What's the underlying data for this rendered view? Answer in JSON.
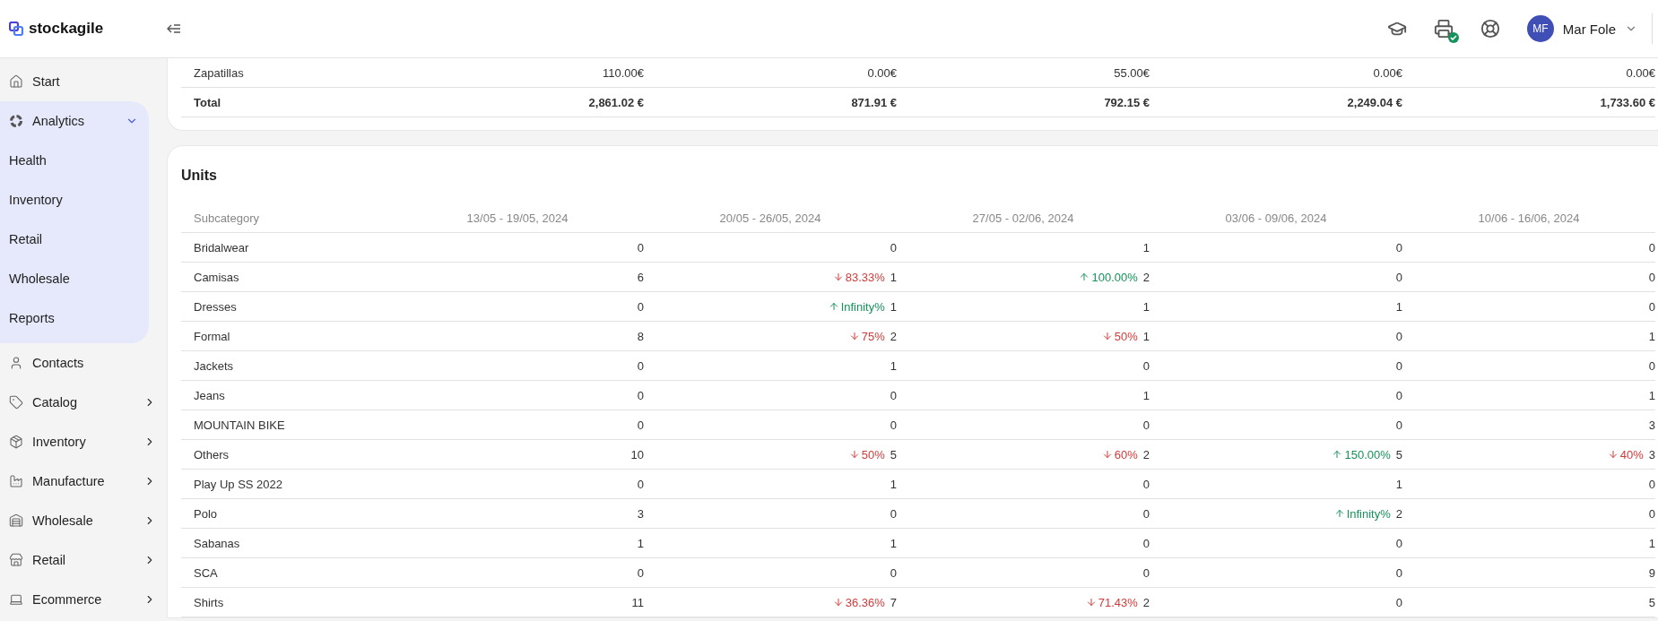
{
  "brand": {
    "name": "stockagile"
  },
  "sidebar": {
    "items": [
      {
        "label": "Start",
        "kind": "link"
      },
      {
        "label": "Analytics",
        "kind": "group",
        "expanded": true,
        "children": [
          {
            "label": "Health"
          },
          {
            "label": "Inventory"
          },
          {
            "label": "Retail"
          },
          {
            "label": "Wholesale"
          },
          {
            "label": "Reports"
          }
        ]
      },
      {
        "label": "Contacts",
        "kind": "link"
      },
      {
        "label": "Catalog",
        "kind": "group",
        "expanded": false
      },
      {
        "label": "Inventory",
        "kind": "group",
        "expanded": false
      },
      {
        "label": "Manufacture",
        "kind": "group",
        "expanded": false
      },
      {
        "label": "Wholesale",
        "kind": "group",
        "expanded": false
      },
      {
        "label": "Retail",
        "kind": "group",
        "expanded": false
      },
      {
        "label": "Ecommerce",
        "kind": "group",
        "expanded": false
      }
    ]
  },
  "header": {
    "printer_connected": true,
    "user": {
      "initials": "MF",
      "name": "Mar Fole"
    }
  },
  "revenue_table": {
    "rows": [
      {
        "kind": "row",
        "label": "Zapatillas",
        "values": [
          "110.00€",
          "0.00€",
          "55.00€",
          "0.00€",
          "0.00€"
        ]
      },
      {
        "kind": "total",
        "label": "Total",
        "values": [
          "2,861.02 €",
          "871.91 €",
          "792.15 €",
          "2,249.04 €",
          "1,733.60 €"
        ]
      }
    ]
  },
  "units": {
    "title": "Units",
    "columns": [
      "Subcategory",
      "13/05 - 19/05, 2024",
      "20/05 - 26/05, 2024",
      "27/05 - 02/06, 2024",
      "03/06 - 09/06, 2024",
      "10/06 - 16/06, 2024"
    ],
    "rows": [
      {
        "label": "Bridalwear",
        "cells": [
          {
            "value": "0"
          },
          {
            "value": "0"
          },
          {
            "value": "1"
          },
          {
            "value": "0"
          },
          {
            "value": "0"
          }
        ]
      },
      {
        "label": "Camisas",
        "cells": [
          {
            "value": "6"
          },
          {
            "value": "1",
            "change": {
              "kind": "decrease",
              "text": "83.33%"
            }
          },
          {
            "value": "2",
            "change": {
              "kind": "increase",
              "text": "100.00%"
            }
          },
          {
            "value": "0"
          },
          {
            "value": "0"
          }
        ]
      },
      {
        "label": "Dresses",
        "cells": [
          {
            "value": "0"
          },
          {
            "value": "1",
            "change": {
              "kind": "increase",
              "text": "Infinity%"
            }
          },
          {
            "value": "1"
          },
          {
            "value": "1"
          },
          {
            "value": "0"
          }
        ]
      },
      {
        "label": "Formal",
        "cells": [
          {
            "value": "8"
          },
          {
            "value": "2",
            "change": {
              "kind": "decrease",
              "text": "75%"
            }
          },
          {
            "value": "1",
            "change": {
              "kind": "decrease",
              "text": "50%"
            }
          },
          {
            "value": "0"
          },
          {
            "value": "1"
          }
        ]
      },
      {
        "label": "Jackets",
        "cells": [
          {
            "value": "0"
          },
          {
            "value": "1"
          },
          {
            "value": "0"
          },
          {
            "value": "0"
          },
          {
            "value": "0"
          }
        ]
      },
      {
        "label": "Jeans",
        "cells": [
          {
            "value": "0"
          },
          {
            "value": "0"
          },
          {
            "value": "1"
          },
          {
            "value": "0"
          },
          {
            "value": "1"
          }
        ]
      },
      {
        "label": "MOUNTAIN BIKE",
        "cells": [
          {
            "value": "0"
          },
          {
            "value": "0"
          },
          {
            "value": "0"
          },
          {
            "value": "0"
          },
          {
            "value": "3"
          }
        ]
      },
      {
        "label": "Others",
        "cells": [
          {
            "value": "10"
          },
          {
            "value": "5",
            "change": {
              "kind": "decrease",
              "text": "50%"
            }
          },
          {
            "value": "2",
            "change": {
              "kind": "decrease",
              "text": "60%"
            }
          },
          {
            "value": "5",
            "change": {
              "kind": "increase",
              "text": "150.00%"
            }
          },
          {
            "value": "3",
            "change": {
              "kind": "decrease",
              "text": "40%"
            }
          }
        ]
      },
      {
        "label": "Play Up SS 2022",
        "cells": [
          {
            "value": "0"
          },
          {
            "value": "1"
          },
          {
            "value": "0"
          },
          {
            "value": "1"
          },
          {
            "value": "0"
          }
        ]
      },
      {
        "label": "Polo",
        "cells": [
          {
            "value": "3"
          },
          {
            "value": "0"
          },
          {
            "value": "0"
          },
          {
            "value": "2",
            "change": {
              "kind": "increase",
              "text": "Infinity%"
            }
          },
          {
            "value": "0"
          }
        ]
      },
      {
        "label": "Sabanas",
        "cells": [
          {
            "value": "1"
          },
          {
            "value": "1"
          },
          {
            "value": "0"
          },
          {
            "value": "0"
          },
          {
            "value": "1"
          }
        ]
      },
      {
        "label": "SCA",
        "cells": [
          {
            "value": "0"
          },
          {
            "value": "0"
          },
          {
            "value": "0"
          },
          {
            "value": "0"
          },
          {
            "value": "9"
          }
        ]
      },
      {
        "label": "Shirts",
        "cells": [
          {
            "value": "11"
          },
          {
            "value": "7",
            "change": {
              "kind": "decrease",
              "text": "36.36%"
            }
          },
          {
            "value": "2",
            "change": {
              "kind": "decrease",
              "text": "71.43%"
            }
          },
          {
            "value": "0"
          },
          {
            "value": "5"
          }
        ]
      }
    ]
  }
}
